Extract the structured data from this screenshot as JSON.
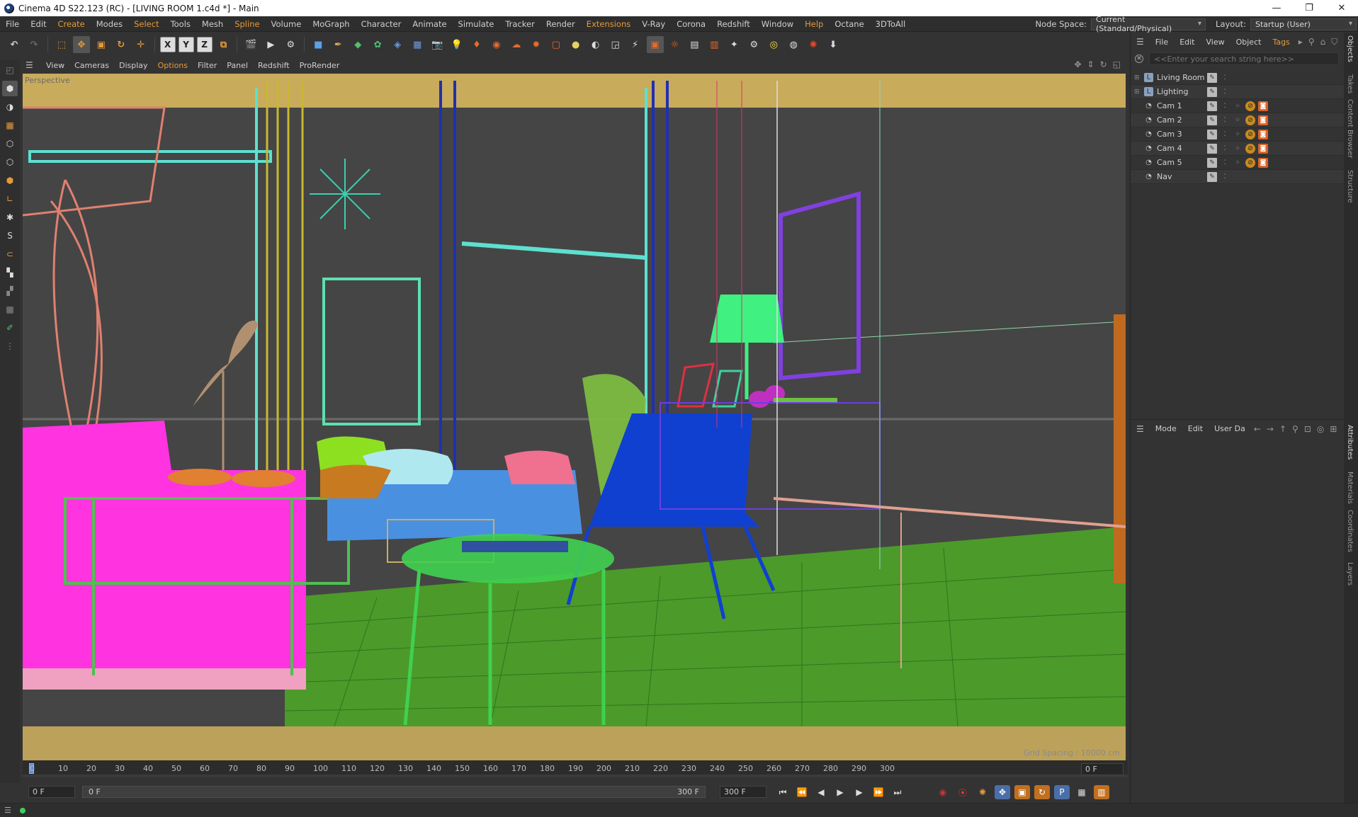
{
  "window": {
    "title": "Cinema 4D S22.123 (RC) - [LIVING ROOM 1.c4d *] - Main",
    "controls": [
      "—",
      "❐",
      "✕"
    ]
  },
  "menubar": {
    "items": [
      "File",
      "Edit",
      "Create",
      "Modes",
      "Select",
      "Tools",
      "Mesh",
      "Spline",
      "Volume",
      "MoGraph",
      "Character",
      "Animate",
      "Simulate",
      "Tracker",
      "Render",
      "Extensions",
      "V-Ray",
      "Corona",
      "Redshift",
      "Window",
      "Help",
      "Octane",
      "3DToAll"
    ],
    "highlighted": [
      "Create",
      "Select",
      "Spline",
      "Extensions",
      "Help"
    ],
    "node_space_label": "Node Space:",
    "node_space_value": "Current (Standard/Physical)",
    "layout_label": "Layout:",
    "layout_value": "Startup (User)"
  },
  "viewport": {
    "menu": [
      "View",
      "Cameras",
      "Display",
      "Options",
      "Filter",
      "Panel",
      "Redshift",
      "ProRender"
    ],
    "highlighted": [
      "Options"
    ],
    "label": "Perspective",
    "grid_spacing": "Grid Spacing : 10000 cm"
  },
  "timeline": {
    "ticks": [
      "0",
      "10",
      "20",
      "30",
      "40",
      "50",
      "60",
      "70",
      "80",
      "90",
      "100",
      "110",
      "120",
      "130",
      "140",
      "150",
      "160",
      "170",
      "180",
      "190",
      "200",
      "210",
      "220",
      "230",
      "240",
      "250",
      "260",
      "270",
      "280",
      "290",
      "300"
    ],
    "current_frame": "0 F",
    "start_frame": "0 F",
    "slider_start": "0 F",
    "slider_end": "300 F",
    "end_frame": "300 F"
  },
  "object_manager": {
    "menu": [
      "File",
      "Edit",
      "View",
      "Object",
      "Tags"
    ],
    "highlighted": [
      "Tags"
    ],
    "search_placeholder": "<<Enter your search string here>>",
    "objects": [
      {
        "name": "Living Room",
        "type": "layer"
      },
      {
        "name": "Lighting",
        "type": "layer"
      },
      {
        "name": "Cam 1",
        "type": "camera"
      },
      {
        "name": "Cam 2",
        "type": "camera"
      },
      {
        "name": "Cam 3",
        "type": "camera"
      },
      {
        "name": "Cam 4",
        "type": "camera"
      },
      {
        "name": "Cam 5",
        "type": "camera"
      },
      {
        "name": "Nav",
        "type": "camera"
      }
    ]
  },
  "attribute_manager": {
    "menu": [
      "Mode",
      "Edit",
      "User Da"
    ]
  },
  "side_tabs_top": [
    "Objects",
    "Takes",
    "Content Browser",
    "Structure"
  ],
  "side_tabs_bottom": [
    "Attributes",
    "Materials",
    "Coordinates",
    "Layers"
  ],
  "colors": {
    "accent": "#e49a3b",
    "panel_bg": "#333333",
    "viewport_bg": "#454545"
  }
}
